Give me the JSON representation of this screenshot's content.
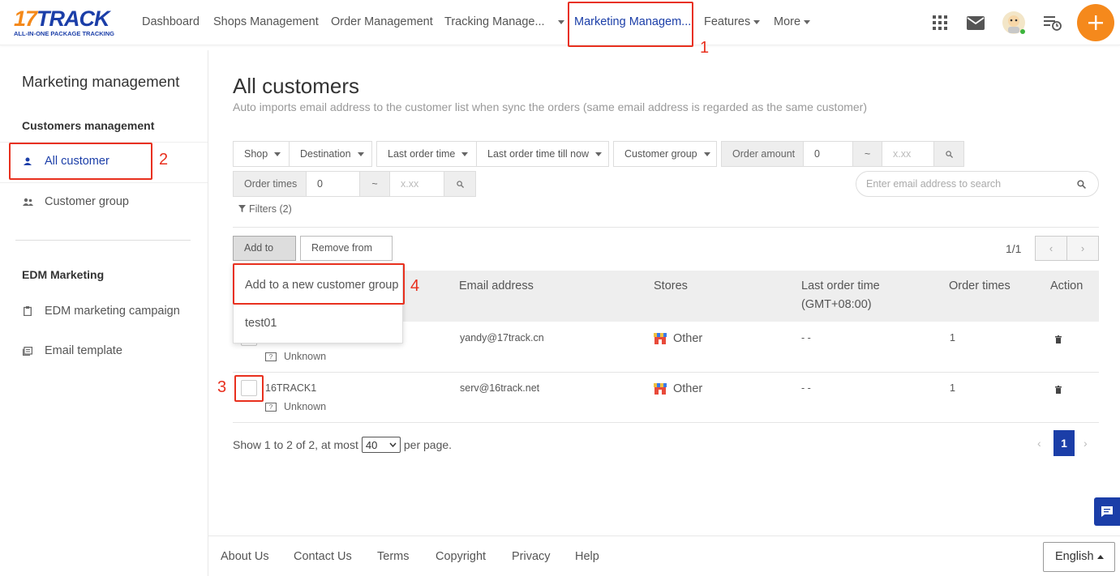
{
  "logo": {
    "brand_number": "17",
    "brand_text": "TRACK",
    "tagline": "ALL-IN-ONE PACKAGE TRACKING"
  },
  "nav": {
    "items": [
      "Dashboard",
      "Shops Management",
      "Order Management",
      "Tracking Manage..."
    ],
    "active": "Marketing Managem...",
    "features": "Features",
    "more": "More"
  },
  "annotations": {
    "n1": "1",
    "n2": "2",
    "n3": "3",
    "n4": "4",
    "color": "#e8301e"
  },
  "sidebar": {
    "title": "Marketing management",
    "section1": "Customers management",
    "item_all_customer": "All customer",
    "item_customer_group": "Customer group",
    "section2": "EDM Marketing",
    "item_edm_campaign": "EDM marketing campaign",
    "item_email_template": "Email template"
  },
  "main": {
    "title": "All customers",
    "subtitle": "Auto imports email address to the customer list when sync the orders (same email address is regarded as the same customer)"
  },
  "filters": {
    "shop": "Shop",
    "destination": "Destination",
    "last_order_time": "Last order time",
    "last_order_time_till_now": "Last order time till now",
    "customer_group": "Customer group",
    "order_amount_label": "Order amount",
    "order_amount_min": "0",
    "tilde": "~",
    "order_amount_max_placeholder": "x.xx",
    "order_times_label": "Order times",
    "order_times_min": "0",
    "order_times_max_placeholder": "x.xx",
    "email_search_placeholder": "Enter email address to search",
    "filters_link": "Filters (2)"
  },
  "toolbar": {
    "add_to": "Add to",
    "remove_from": "Remove from",
    "page_indicator": "1/1",
    "prev": "‹",
    "next": "›"
  },
  "dropdown": {
    "items": [
      "Add to a new customer group",
      "test01"
    ]
  },
  "table": {
    "headers": {
      "email": "Email address",
      "stores": "Stores",
      "last_order_time_line1": "Last order time",
      "last_order_time_line2": "(GMT+08:00)",
      "order_times": "Order times",
      "action": "Action"
    },
    "rows": [
      {
        "name": "",
        "country": "Unknown",
        "email": "yandy@17track.cn",
        "store": "Other",
        "last_order": "- -",
        "order_times": "1"
      },
      {
        "name": "16TRACK1",
        "country": "Unknown",
        "email": "serv@16track.net",
        "store": "Other",
        "last_order": "- -",
        "order_times": "1"
      }
    ]
  },
  "pagination": {
    "show_prefix": "Show 1 to 2 of 2, at most",
    "per_page_value": "40",
    "per_page_suffix": "per page.",
    "current_page": "1",
    "prev": "‹",
    "next": "›"
  },
  "footer": {
    "links": [
      "About Us",
      "Contact Us",
      "Terms",
      "Copyright",
      "Privacy",
      "Help"
    ],
    "language": "English"
  },
  "colors": {
    "brand": "#1b3ea8",
    "accent": "#f5891c",
    "annotation": "#e8301e"
  }
}
